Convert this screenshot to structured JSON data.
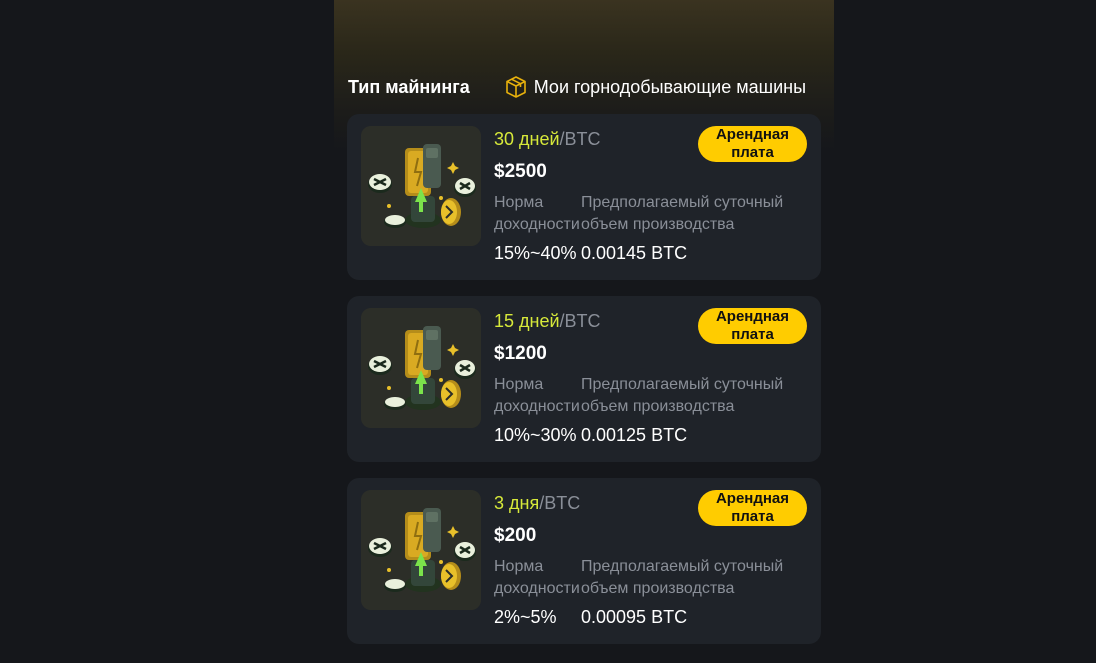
{
  "tabs": {
    "active_label": "Тип майнинга",
    "machines_label": "Мои горнодобывающие машины",
    "machines_icon": "box-icon"
  },
  "colors": {
    "accent_yellow": "#ffcc00",
    "term_green": "#d7e93a",
    "card_bg": "#1f2329",
    "page_bg": "#15171b",
    "muted_text": "#8a8f98"
  },
  "plans": [
    {
      "term": "30 дней",
      "term_unit": "/BTC",
      "price": "$2500",
      "rate_label": "Норма доходности",
      "output_label": "Предполагаемый суточный объем производства",
      "rate_value": "15%~40%",
      "output_value": "0.00145 BTC",
      "button_label": "Арендная плата",
      "image_icon": "mining-machine-icon"
    },
    {
      "term": "15 дней",
      "term_unit": "/BTC",
      "price": "$1200",
      "rate_label": "Норма доходности",
      "output_label": "Предполагаемый суточный объем производства",
      "rate_value": "10%~30%",
      "output_value": "0.00125 BTC",
      "button_label": "Арендная плата",
      "image_icon": "mining-machine-icon"
    },
    {
      "term": "3 дня",
      "term_unit": "/BTC",
      "price": "$200",
      "rate_label": "Норма доходности",
      "output_label": "Предполагаемый суточный объем производства",
      "rate_value": "2%~5%",
      "output_value": "0.00095 BTC",
      "button_label": "Арендная плата",
      "image_icon": "mining-machine-icon"
    }
  ]
}
